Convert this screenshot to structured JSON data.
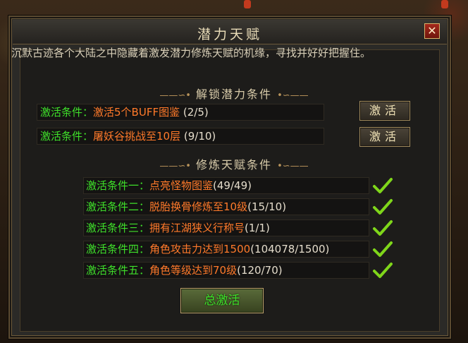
{
  "title": "潜力天赋",
  "close_label": "✕",
  "intro": "沉默古迹各个大陆之中隐藏着激发潜力修炼天赋的机缘，寻找并好好把握住。",
  "unlock_section": {
    "heading": "解锁潜力条件",
    "items": [
      {
        "prefix": "激活条件：",
        "text": "激活5个BUFF图鉴",
        "progress": "(2/5)",
        "button": "激活"
      },
      {
        "prefix": "激活条件：",
        "text": "屠妖谷挑战至10层",
        "progress": "(9/10)",
        "button": "激活"
      }
    ]
  },
  "talent_section": {
    "heading": "修炼天赋条件",
    "items": [
      {
        "prefix": "激活条件一：",
        "text": "点亮怪物图鉴",
        "progress": "(49/49)",
        "done": true
      },
      {
        "prefix": "激活条件二：",
        "text": "脱胎换骨修炼至10级",
        "progress": "(15/10)",
        "done": true
      },
      {
        "prefix": "激活条件三：",
        "text": "拥有江湖狭义行称号",
        "progress": "(1/1)",
        "done": true
      },
      {
        "prefix": "激活条件四：",
        "text": "角色攻击力达到1500",
        "progress": "(104078/1500)",
        "done": true
      },
      {
        "prefix": "激活条件五：",
        "text": "角色等级达到70级",
        "progress": "(120/70)",
        "done": true
      }
    ]
  },
  "total_button": "总激活",
  "colors": {
    "condition_green": "#3fe02a",
    "condition_orange": "#ff7a2a",
    "check_green": "#7fd61a"
  }
}
